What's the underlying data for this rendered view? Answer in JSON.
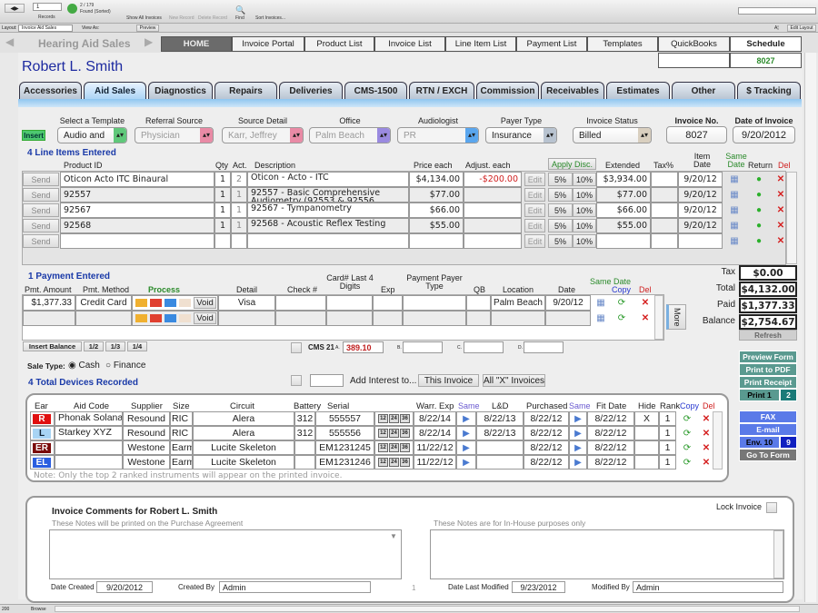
{
  "toolbar": {
    "record_no": "1",
    "records_label": "Records",
    "found": "2 / 179",
    "found_status": "Found (Sorted)",
    "show_all": "Show All Invoices",
    "new_record": "New Record",
    "delete_record": "Delete Record",
    "find": "Find",
    "sort": "Sort Invoices..."
  },
  "layoutbar": {
    "layout_label": "Layout:",
    "layout_value": "Invoice Aid Sales",
    "view_as": "View As:",
    "preview": "Preview",
    "aa": "A¦",
    "edit_layout": "Edit Layout"
  },
  "nav": {
    "title": "Hearing Aid Sales",
    "items": [
      "HOME",
      "Invoice Portal",
      "Product List",
      "Invoice List",
      "Line Item List",
      "Payment List",
      "Templates",
      "QuickBooks",
      "Schedule"
    ],
    "schedule_value": "8027"
  },
  "patient_name": "Robert L. Smith",
  "tabs": [
    "Accessories",
    "Aid Sales",
    "Diagnostics",
    "Repairs",
    "Deliveries",
    "CMS-1500",
    "RTN / EXCH",
    "Commission",
    "Receivables",
    "Estimates",
    "Other",
    "$ Tracking"
  ],
  "header": {
    "insert": "Insert",
    "fields": [
      {
        "label": "Select a Template",
        "value": "Audio and",
        "arrow_color": "#5fc87a"
      },
      {
        "label": "Referral Source",
        "value": "Physician",
        "arrow_color": "#e98aa5"
      },
      {
        "label": "Source Detail",
        "value": "Karr, Jeffrey",
        "arrow_color": "#e98aa5"
      },
      {
        "label": "Office",
        "value": "Palm Beach",
        "arrow_color": "#9a8ae0"
      },
      {
        "label": "Audiologist",
        "value": "PR",
        "arrow_color": "#5aa6ee"
      },
      {
        "label": "Payer Type",
        "value": "Insurance",
        "arrow_color": "#b8c3d0"
      },
      {
        "label": "Invoice Status",
        "value": "Billed",
        "arrow_color": "#d9cfbf"
      }
    ],
    "invoice_no_label": "Invoice No.",
    "invoice_no": "8027",
    "date_label": "Date of Invoice",
    "date": "9/20/2012"
  },
  "line_items": {
    "title": "4 Line Items Entered",
    "headers": {
      "product_id": "Product ID",
      "qty": "Qty",
      "act": "Act.",
      "description": "Description",
      "price": "Price each",
      "adjust": "Adjust. each",
      "apply_disc": "Apply Disc.",
      "extended": "Extended",
      "tax": "Tax%",
      "item_date": "Item Date",
      "same_date": "Same Date",
      "return": "Return",
      "del": "Del"
    },
    "send": "Send",
    "edit": "Edit",
    "d5": "5%",
    "d10": "10%",
    "rows": [
      {
        "product_id": "Oticon Acto ITC Binaural",
        "qty": "1",
        "act": "2",
        "description": "Oticon - Acto - ITC",
        "price": "$4,134.00",
        "adjust": "-$200.00",
        "extended": "$3,934.00",
        "tax": "",
        "date": "9/20/12"
      },
      {
        "product_id": "92557",
        "qty": "1",
        "act": "1",
        "description": "92557 - Basic Comprehensive Audiometry (92553 & 92556",
        "price": "$77.00",
        "adjust": "",
        "extended": "$77.00",
        "tax": "",
        "date": "9/20/12"
      },
      {
        "product_id": "92567",
        "qty": "1",
        "act": "1",
        "description": "92567 - Tympanometry",
        "price": "$66.00",
        "adjust": "",
        "extended": "$66.00",
        "tax": "",
        "date": "9/20/12"
      },
      {
        "product_id": "92568",
        "qty": "1",
        "act": "1",
        "description": "92568 - Acoustic Reflex Testing",
        "price": "$55.00",
        "adjust": "",
        "extended": "$55.00",
        "tax": "",
        "date": "9/20/12"
      },
      {
        "product_id": "",
        "qty": "",
        "act": "",
        "description": "",
        "price": "",
        "adjust": "",
        "extended": "",
        "tax": "",
        "date": ""
      }
    ]
  },
  "payments": {
    "title": "1 Payment Entered",
    "headers": {
      "amount": "Pmt. Amount",
      "method": "Pmt. Method",
      "process": "Process",
      "detail": "Detail",
      "check": "Check #",
      "card": "Card# Last 4 Digits",
      "exp": "Exp",
      "payer": "Payment Payer Type",
      "qb": "QB",
      "location": "Location",
      "date": "Date",
      "same": "Same Date",
      "copy": "Copy",
      "del": "Del"
    },
    "void": "Void",
    "more": "More",
    "rows": [
      {
        "amount": "$1,377.33",
        "method": "Credit Card",
        "detail": "Visa",
        "check": "",
        "card": "",
        "exp": "",
        "payer": "",
        "qb": "",
        "location": "Palm Beach",
        "date": "9/20/12"
      },
      {
        "amount": "",
        "method": "",
        "detail": "",
        "check": "",
        "card": "",
        "exp": "",
        "payer": "",
        "qb": "",
        "location": "",
        "date": ""
      }
    ],
    "insert_balance": "Insert Balance",
    "fractions": [
      "1/2",
      "1/3",
      "1/4"
    ],
    "cms_label": "CMS 21",
    "cms_a": "A.",
    "cms_a_value": "389.10",
    "cms_b": "B.",
    "cms_c": "C.",
    "cms_d": "D."
  },
  "totals": {
    "tax_label": "Tax",
    "tax": "$0.00",
    "total_label": "Total",
    "total": "$4,132.00",
    "paid_label": "Paid",
    "paid": "$1,377.33",
    "balance_label": "Balance",
    "balance": "$2,754.67",
    "refresh": "Refresh"
  },
  "print": {
    "preview": "Preview Form",
    "pdf": "Print to PDF",
    "receipt": "Print Receipt",
    "print1": "Print 1",
    "print_count": "2",
    "fax": "FAX",
    "email": "E-mail",
    "env": "Env. 10",
    "env_count": "9",
    "goto": "Go To Form"
  },
  "sale_type": {
    "label": "Sale Type:",
    "options": [
      "Cash",
      "Finance"
    ],
    "selected": "Cash"
  },
  "interest": {
    "label": "Add Interest to...",
    "this_invoice": "This Invoice",
    "all_x": "All \"X\" Invoices"
  },
  "devices": {
    "title": "4 Total Devices Recorded",
    "headers": {
      "ear": "Ear",
      "aid_code": "Aid Code",
      "supplier": "Supplier",
      "size": "Size",
      "circuit": "Circuit",
      "battery": "Battery",
      "serial": "Serial",
      "warr": "Warr. Exp",
      "same": "Same",
      "ld": "L&D",
      "purchased": "Purchased",
      "same2": "Same",
      "fit": "Fit Date",
      "hide": "Hide",
      "rank": "Rank",
      "copy": "Copy",
      "del": "Del"
    },
    "warranty_options": [
      "12",
      "24",
      "36"
    ],
    "rows": [
      {
        "ear": "R",
        "ear_color": "#e01010",
        "aid_code": "Phonak Solana",
        "supplier": "Resound",
        "size": "RIC",
        "circuit": "Alera",
        "battery": "312",
        "serial": "555557",
        "warr": "8/22/14",
        "ld": "8/22/13",
        "purchased": "8/22/12",
        "fit": "8/22/12",
        "hide": "X",
        "rank": "1"
      },
      {
        "ear": "L",
        "ear_color": "#a8d4f4",
        "aid_code": "Starkey XYZ",
        "supplier": "Resound",
        "size": "RIC",
        "circuit": "Alera",
        "battery": "312",
        "serial": "555556",
        "warr": "8/22/14",
        "ld": "8/22/13",
        "purchased": "8/22/12",
        "fit": "8/22/12",
        "hide": "",
        "rank": "1"
      },
      {
        "ear": "ER",
        "ear_color": "#7a0a0a",
        "aid_code": "",
        "supplier": "Westone",
        "size": "Earm",
        "circuit": "Lucite Skeleton",
        "battery": "",
        "serial": "EM1231245",
        "warr": "11/22/12",
        "ld": "",
        "purchased": "8/22/12",
        "fit": "8/22/12",
        "hide": "",
        "rank": "1"
      },
      {
        "ear": "EL",
        "ear_color": "#2a5ee0",
        "aid_code": "",
        "supplier": "Westone",
        "size": "Earm",
        "circuit": "Lucite Skeleton",
        "battery": "",
        "serial": "EM1231246",
        "warr": "11/22/12",
        "ld": "",
        "purchased": "8/22/12",
        "fit": "8/22/12",
        "hide": "",
        "rank": "1"
      }
    ],
    "note": "Note: Only the top 2 ranked instruments will appear on the printed invoice."
  },
  "comments": {
    "title": "Invoice Comments for Robert L. Smith",
    "left_sub": "These Notes will be printed on the Purchase Agreement",
    "right_sub": "These Notes are for In-House purposes only",
    "lock": "Lock Invoice",
    "left_notes": "",
    "right_notes": "",
    "date_created_label": "Date Created",
    "date_created": "9/20/2012",
    "created_by_label": "Created By",
    "created_by": "Admin",
    "page_marker": "1",
    "modified_label": "Date Last Modified",
    "modified": "9/23/2012",
    "modified_by_label": "Modified By",
    "modified_by": "Admin"
  },
  "statusbar": {
    "zoom": "200",
    "mode": "Browse"
  }
}
